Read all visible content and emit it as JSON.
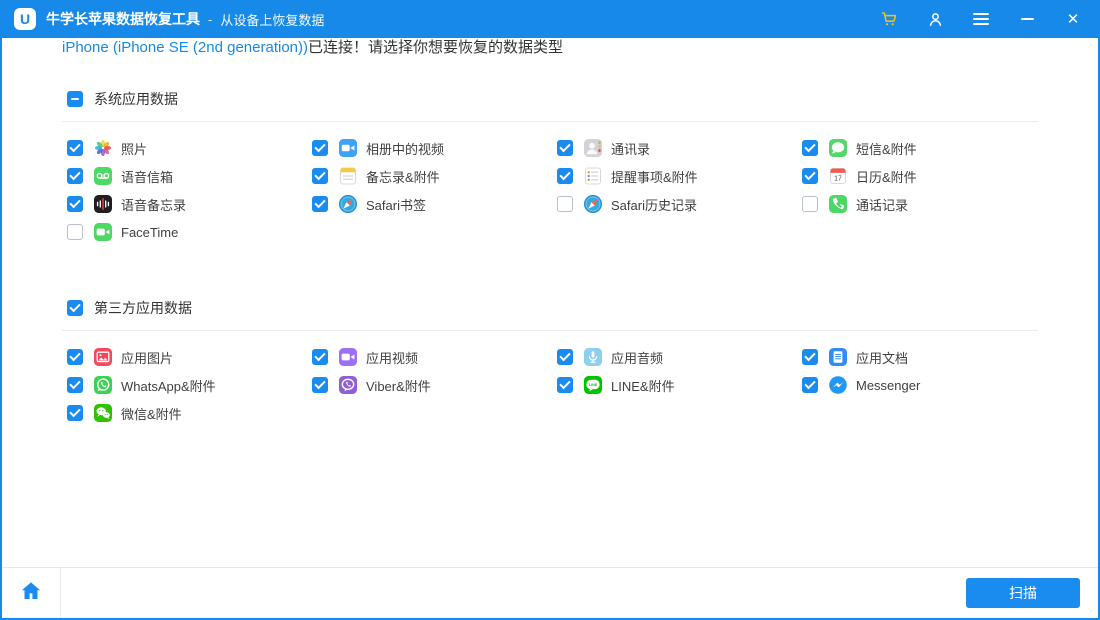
{
  "colors": {
    "accent": "#1789e8",
    "control_blue": "#1a8cf0",
    "cart_gold": "#ffc107"
  },
  "titlebar": {
    "app_title": "牛学长苹果数据恢复工具",
    "separator": "-",
    "subtitle": "从设备上恢复数据",
    "icons": [
      "cart-icon",
      "user-icon",
      "menu-icon",
      "minimize-icon",
      "close-icon"
    ]
  },
  "header": {
    "device": "iPhone (iPhone SE (2nd generation))",
    "message": "已连接！请选择你想要恢复的数据类型"
  },
  "sections": [
    {
      "title": "系统应用数据",
      "checkbox_state": "indeterminate",
      "items": [
        {
          "label": "照片",
          "icon": "photos-icon",
          "checked": true
        },
        {
          "label": "相册中的视频",
          "icon": "album-video-icon",
          "checked": true
        },
        {
          "label": "通讯录",
          "icon": "contacts-icon",
          "checked": true
        },
        {
          "label": "短信&附件",
          "icon": "messages-icon",
          "checked": true
        },
        {
          "label": "语音信箱",
          "icon": "voicemail-icon",
          "checked": true
        },
        {
          "label": "备忘录&附件",
          "icon": "notes-icon",
          "checked": true
        },
        {
          "label": "提醒事项&附件",
          "icon": "reminders-icon",
          "checked": true
        },
        {
          "label": "日历&附件",
          "icon": "calendar-icon",
          "checked": true
        },
        {
          "label": "语音备忘录",
          "icon": "voice-memos-icon",
          "checked": true
        },
        {
          "label": "Safari书签",
          "icon": "safari-icon",
          "checked": true
        },
        {
          "label": "Safari历史记录",
          "icon": "safari-icon",
          "checked": false
        },
        {
          "label": "通话记录",
          "icon": "phone-icon",
          "checked": false
        },
        {
          "label": "FaceTime",
          "icon": "facetime-icon",
          "checked": false
        }
      ]
    },
    {
      "title": "第三方应用数据",
      "checkbox_state": "checked",
      "items": [
        {
          "label": "应用图片",
          "icon": "app-image-icon",
          "checked": true
        },
        {
          "label": "应用视频",
          "icon": "app-video-icon",
          "checked": true
        },
        {
          "label": "应用音频",
          "icon": "app-audio-icon",
          "checked": true
        },
        {
          "label": "应用文档",
          "icon": "app-doc-icon",
          "checked": true
        },
        {
          "label": "WhatsApp&附件",
          "icon": "whatsapp-icon",
          "checked": true
        },
        {
          "label": "Viber&附件",
          "icon": "viber-icon",
          "checked": true
        },
        {
          "label": "LINE&附件",
          "icon": "line-icon",
          "checked": true
        },
        {
          "label": "Messenger",
          "icon": "messenger-icon",
          "checked": true
        },
        {
          "label": "微信&附件",
          "icon": "wechat-icon",
          "checked": true
        }
      ]
    }
  ],
  "footer": {
    "home_icon": "home-icon",
    "scan_label": "扫描"
  }
}
